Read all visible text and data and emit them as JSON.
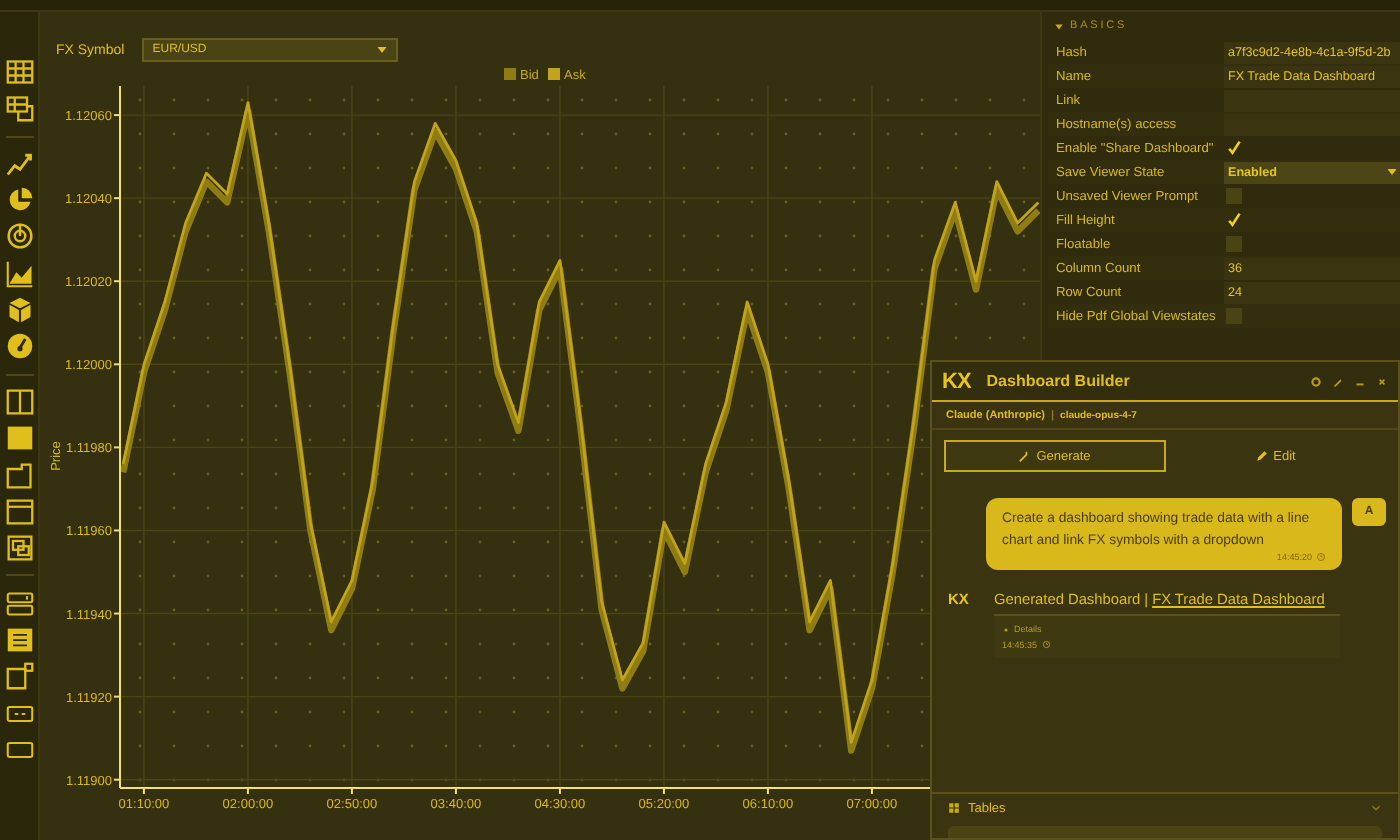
{
  "fx_symbol": {
    "label": "FX Symbol",
    "value": "EUR/USD"
  },
  "chart": {
    "chart_data": {
      "type": "line",
      "ylabel": "Price",
      "x": [
        60,
        70,
        80,
        90,
        100,
        110,
        120,
        130,
        140,
        150,
        160,
        170,
        180,
        190,
        200,
        210,
        220,
        230,
        240,
        250,
        260,
        270,
        280,
        290,
        300,
        310,
        320,
        330,
        340,
        350,
        360,
        370,
        380,
        390,
        400,
        410,
        420,
        430,
        440,
        450,
        460,
        470,
        480,
        490,
        500
      ],
      "xlim": [
        58.5,
        500.8
      ],
      "grid": true,
      "legend": "top",
      "series": [
        {
          "name": "Bid",
          "color": "#8f7d12",
          "values": [
            1.11974,
            1.11998,
            1.12013,
            1.12032,
            1.12044,
            1.12039,
            1.12061,
            1.12032,
            1.11998,
            1.1196,
            1.11936,
            1.11946,
            1.1197,
            1.12008,
            1.12042,
            1.12056,
            1.12047,
            1.12032,
            1.11998,
            1.11984,
            1.12013,
            1.12023,
            1.11984,
            1.11941,
            1.11922,
            1.11931,
            1.1196,
            1.1195,
            1.11974,
            1.11989,
            1.12013,
            1.11998,
            1.1197,
            1.11936,
            1.11946,
            1.11907,
            1.11922,
            1.1195,
            1.11984,
            1.12023,
            1.12037,
            1.12018,
            1.12042,
            1.12032,
            1.12037
          ]
        },
        {
          "name": "Ask",
          "color": "#c2a41c",
          "values": [
            1.11976,
            1.12,
            1.12015,
            1.12034,
            1.12046,
            1.12041,
            1.12063,
            1.12034,
            1.12,
            1.11962,
            1.11938,
            1.11948,
            1.11972,
            1.1201,
            1.12044,
            1.12058,
            1.12049,
            1.12034,
            1.12,
            1.11986,
            1.12015,
            1.12025,
            1.11986,
            1.11943,
            1.11924,
            1.11933,
            1.11962,
            1.11952,
            1.11976,
            1.11991,
            1.12015,
            1.12,
            1.11972,
            1.11938,
            1.11948,
            1.11909,
            1.11924,
            1.11952,
            1.11986,
            1.12025,
            1.12039,
            1.1202,
            1.12044,
            1.12034,
            1.12039
          ]
        }
      ],
      "ylim": [
        1.11898,
        1.12067
      ],
      "yticks": [
        {
          "value": 1.119,
          "label": "1.11900"
        },
        {
          "value": 1.1192,
          "label": "1.11920"
        },
        {
          "value": 1.1194,
          "label": "1.11940"
        },
        {
          "value": 1.1196,
          "label": "1.11960"
        },
        {
          "value": 1.1198,
          "label": "1.11980"
        },
        {
          "value": 1.12,
          "label": "1.12000"
        },
        {
          "value": 1.1202,
          "label": "1.12020"
        },
        {
          "value": 1.1204,
          "label": "1.12040"
        },
        {
          "value": 1.1206,
          "label": "1.12060"
        }
      ],
      "xticks": [
        {
          "value": 70,
          "label": "01:10:00"
        },
        {
          "value": 120,
          "label": "02:00:00"
        },
        {
          "value": 170,
          "label": "02:50:00"
        },
        {
          "value": 220,
          "label": "03:40:00"
        },
        {
          "value": 270,
          "label": "04:30:00"
        },
        {
          "value": 320,
          "label": "05:20:00"
        },
        {
          "value": 370,
          "label": "06:10:00"
        },
        {
          "value": 420,
          "label": "07:00:00"
        }
      ]
    }
  },
  "properties": {
    "section": "BASICS",
    "expanded": true,
    "rows": [
      {
        "label": "Hash",
        "kind": "text",
        "value": "a7f3c9d2-4e8b-4c1a-9f5d-2b"
      },
      {
        "label": "Name",
        "kind": "text",
        "value": "FX Trade Data Dashboard"
      },
      {
        "label": "Link",
        "kind": "text"
      },
      {
        "label": "Hostname(s) access",
        "kind": "text"
      },
      {
        "label": "Enable \"Share Dashboard\"",
        "kind": "checkbox",
        "checked": true
      },
      {
        "label": "Save Viewer State",
        "kind": "select",
        "value": "Enabled"
      },
      {
        "label": "Unsaved Viewer Prompt",
        "kind": "checkbox",
        "checked": false
      },
      {
        "label": "Fill Height",
        "kind": "checkbox",
        "checked": true
      },
      {
        "label": "Floatable",
        "kind": "checkbox",
        "checked": false
      },
      {
        "label": "Column Count",
        "kind": "text",
        "value": "36"
      },
      {
        "label": "Row Count",
        "kind": "text",
        "value": "24"
      },
      {
        "label": "Hide Pdf Global Viewstates",
        "kind": "checkbox",
        "checked": false
      }
    ]
  },
  "dashboard_builder": {
    "logo": "KX",
    "title": "Dashboard Builder",
    "provider": "Claude (Anthropic)",
    "separator": "|",
    "model": "claude-opus-4-7",
    "tabs": [
      {
        "label": "Generate",
        "selected": true
      },
      {
        "label": "Edit",
        "selected": false
      }
    ],
    "messages": [
      {
        "kind": "user",
        "avatar": "A",
        "text": "Create a dashboard showing trade data with a line chart and link FX symbols with a dropdown",
        "time": "14:45:20"
      },
      {
        "kind": "assistant",
        "avatar": "KX",
        "title": "Generated Dashboard",
        "separator": "|",
        "link": "FX Trade Data Dashboard",
        "details": "Details",
        "time": "14:45:35"
      }
    ],
    "section": {
      "label": "Tables",
      "expanded": false
    }
  }
}
